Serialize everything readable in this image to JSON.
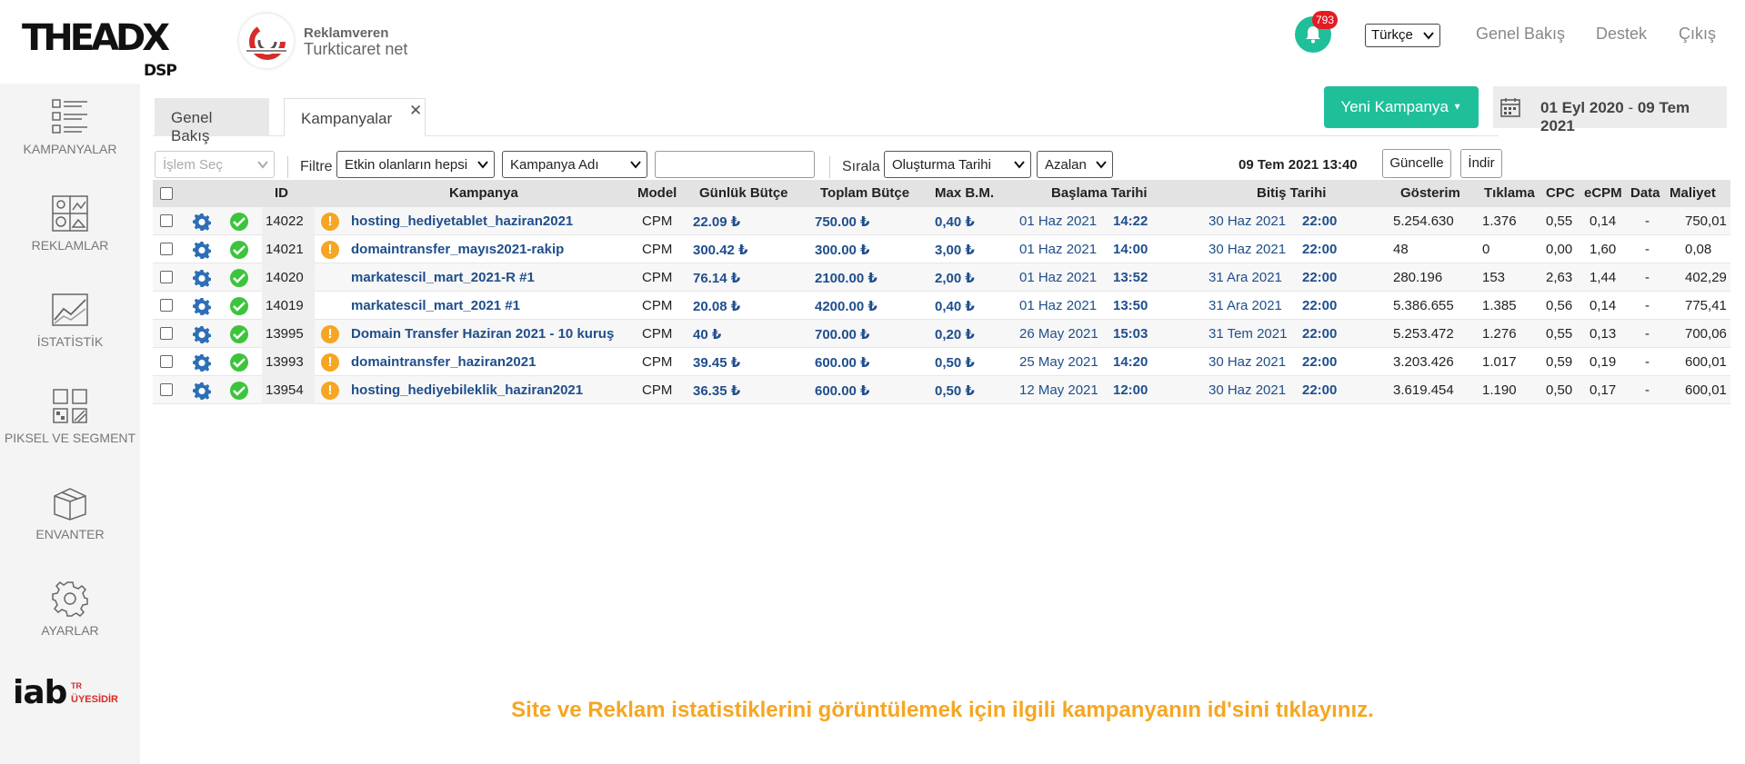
{
  "header": {
    "logo_main": "THEADX",
    "logo_sub": "DSP",
    "advertiser_label": "Reklamveren",
    "advertiser_name": "Turkticaret net",
    "notification_count": "793",
    "language": "Türkçe",
    "nav": [
      "Genel Bakış",
      "Destek",
      "Çıkış"
    ]
  },
  "sidebar": {
    "items": [
      {
        "label": "KAMPANYALAR",
        "icon": "campaigns-icon"
      },
      {
        "label": "REKLAMLAR",
        "icon": "ads-icon"
      },
      {
        "label": "İSTATİSTİK",
        "icon": "statistics-icon"
      },
      {
        "label": "PIKSEL VE SEGMENT",
        "icon": "pixel-segment-icon"
      },
      {
        "label": "ENVANTER",
        "icon": "inventory-icon"
      },
      {
        "label": "AYARLAR",
        "icon": "settings-icon"
      }
    ],
    "iab_text": "iab",
    "iab_tr": "TR",
    "iab_member": "ÜYESİDİR"
  },
  "tabs": {
    "tab1": "Genel Bakış",
    "tab2": "Kampanyalar",
    "new_campaign": "Yeni Kampanya",
    "date_start": "01 Eyl 2020",
    "date_sep": "-",
    "date_end": "09 Tem 2021"
  },
  "filters": {
    "action_select": "İşlem Seç",
    "filter_label": "Filtre",
    "filter_value": "Etkin olanların hepsi",
    "field_value": "Kampanya Adı",
    "search_value": "",
    "sort_label": "Sırala",
    "sort_value": "Oluşturma Tarihi",
    "order_value": "Azalan",
    "now": "09 Tem 2021 13:40",
    "refresh": "Güncelle",
    "download": "İndir"
  },
  "table": {
    "headers": [
      "ID",
      "Kampanya",
      "Model",
      "Günlük Bütçe",
      "Toplam Bütçe",
      "Max B.M.",
      "Başlama Tarihi",
      "Bitiş Tarihi",
      "Gösterim",
      "Tıklama",
      "CPC",
      "eCPM",
      "Data",
      "Maliyet"
    ],
    "rows": [
      {
        "id": "14022",
        "warn": true,
        "name": "hosting_hediyetablet_haziran2021",
        "model": "CPM",
        "daily": "22.09 ₺",
        "total": "750.00 ₺",
        "maxbm": "0,40 ₺",
        "start_date": "01 Haz 2021",
        "start_time": "14:22",
        "end_date": "30 Haz 2021",
        "end_time": "22:00",
        "impr": "5.254.630",
        "clicks": "1.376",
        "cpc": "0,55",
        "ecpm": "0,14",
        "data": "-",
        "cost": "750,01"
      },
      {
        "id": "14021",
        "warn": true,
        "name": "domaintransfer_mayıs2021-rakip",
        "model": "CPM",
        "daily": "300.42 ₺",
        "total": "300.00 ₺",
        "maxbm": "3,00 ₺",
        "start_date": "01 Haz 2021",
        "start_time": "14:00",
        "end_date": "30 Haz 2021",
        "end_time": "22:00",
        "impr": "48",
        "clicks": "0",
        "cpc": "0,00",
        "ecpm": "1,60",
        "data": "-",
        "cost": "0,08"
      },
      {
        "id": "14020",
        "warn": false,
        "name": "markatescil_mart_2021-R #1",
        "model": "CPM",
        "daily": "76.14 ₺",
        "total": "2100.00 ₺",
        "maxbm": "2,00 ₺",
        "start_date": "01 Haz 2021",
        "start_time": "13:52",
        "end_date": "31 Ara 2021",
        "end_time": "22:00",
        "impr": "280.196",
        "clicks": "153",
        "cpc": "2,63",
        "ecpm": "1,44",
        "data": "-",
        "cost": "402,29"
      },
      {
        "id": "14019",
        "warn": false,
        "name": "markatescil_mart_2021 #1",
        "model": "CPM",
        "daily": "20.08 ₺",
        "total": "4200.00 ₺",
        "maxbm": "0,40 ₺",
        "start_date": "01 Haz 2021",
        "start_time": "13:50",
        "end_date": "31 Ara 2021",
        "end_time": "22:00",
        "impr": "5.386.655",
        "clicks": "1.385",
        "cpc": "0,56",
        "ecpm": "0,14",
        "data": "-",
        "cost": "775,41"
      },
      {
        "id": "13995",
        "warn": true,
        "name": "Domain Transfer Haziran 2021 - 10 kuruş",
        "model": "CPM",
        "daily": "40 ₺",
        "total": "700.00 ₺",
        "maxbm": "0,20 ₺",
        "start_date": "26 May 2021",
        "start_time": "15:03",
        "end_date": "31 Tem 2021",
        "end_time": "22:00",
        "impr": "5.253.472",
        "clicks": "1.276",
        "cpc": "0,55",
        "ecpm": "0,13",
        "data": "-",
        "cost": "700,06"
      },
      {
        "id": "13993",
        "warn": true,
        "name": "domaintransfer_haziran2021",
        "model": "CPM",
        "daily": "39.45 ₺",
        "total": "600.00 ₺",
        "maxbm": "0,50 ₺",
        "start_date": "25 May 2021",
        "start_time": "14:20",
        "end_date": "30 Haz 2021",
        "end_time": "22:00",
        "impr": "3.203.426",
        "clicks": "1.017",
        "cpc": "0,59",
        "ecpm": "0,19",
        "data": "-",
        "cost": "600,01"
      },
      {
        "id": "13954",
        "warn": true,
        "name": "hosting_hediyebileklik_haziran2021",
        "model": "CPM",
        "daily": "36.35 ₺",
        "total": "600.00 ₺",
        "maxbm": "0,50 ₺",
        "start_date": "12 May 2021",
        "start_time": "12:00",
        "end_date": "30 Haz 2021",
        "end_time": "22:00",
        "impr": "3.619.454",
        "clicks": "1.190",
        "cpc": "0,50",
        "ecpm": "0,17",
        "data": "-",
        "cost": "600,01"
      }
    ]
  },
  "info_message": "Site ve Reklam istatistiklerini görüntülemek için ilgili kampanyanın id'sini tıklayınız.",
  "colors": {
    "accent": "#1fbf9a",
    "link": "#1f4e8c",
    "warning": "#f5a623",
    "badge": "#e51b24",
    "ok": "#3cc43c"
  }
}
